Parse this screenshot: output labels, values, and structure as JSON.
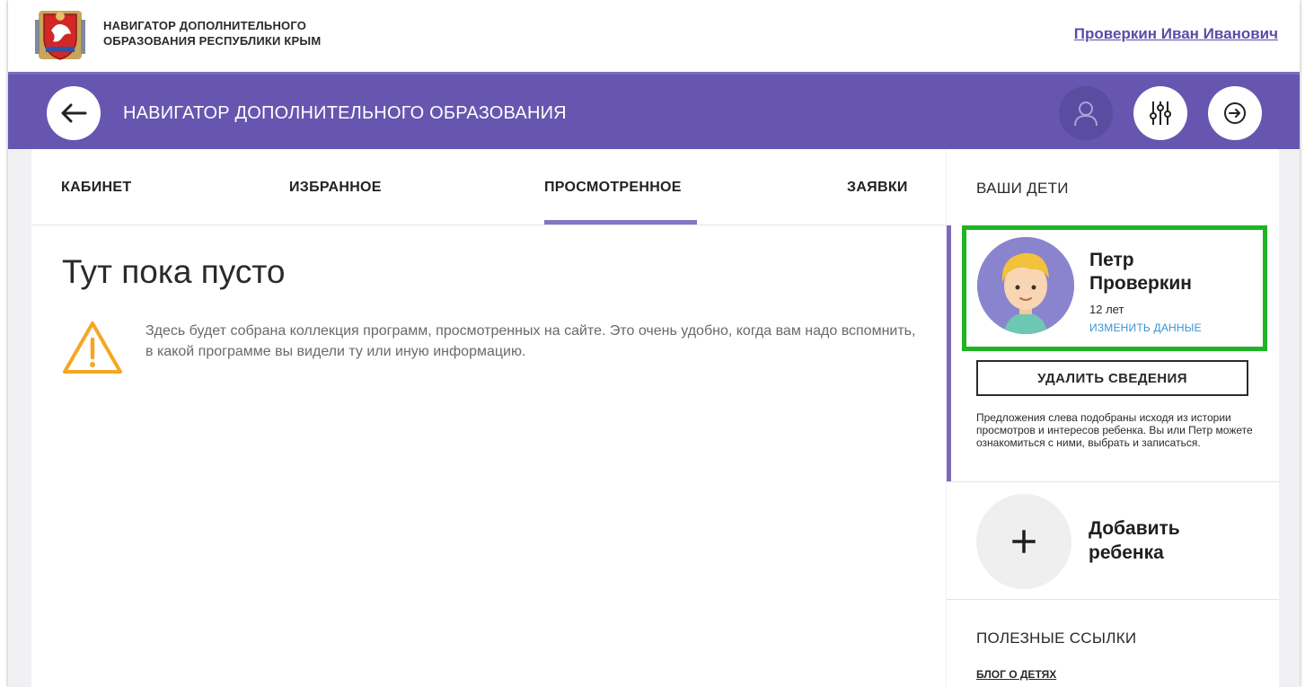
{
  "site": {
    "title_line1": "НАВИГАТОР ДОПОЛНИТЕЛЬНОГО",
    "title_line2": "ОБРАЗОВАНИЯ РЕСПУБЛИКИ КРЫМ",
    "user_name": "Проверкин Иван Иванович"
  },
  "header": {
    "title": "НАВИГАТОР ДОПОЛНИТЕЛЬНОГО ОБРАЗОВАНИЯ",
    "back_icon": "arrow-left-icon",
    "profile_icon": "user-icon",
    "filter_icon": "sliders-icon",
    "exit_icon": "exit-arrow-icon",
    "accent_color": "#6656b0"
  },
  "tabs": [
    {
      "label": "КАБИНЕТ",
      "active": false
    },
    {
      "label": "ИЗБРАННОЕ",
      "active": false
    },
    {
      "label": "ПРОСМОТРЕННОЕ",
      "active": true
    },
    {
      "label": "ЗАЯВКИ",
      "active": false
    }
  ],
  "empty_state": {
    "title": "Тут пока пусто",
    "text": "Здесь будет собрана коллекция программ, просмотренных на сайте. Это очень удобно, когда вам надо вспомнить, в какой программе вы видели ту или иную информацию.",
    "icon": "warning-icon",
    "icon_color": "#f5a623"
  },
  "sidebar": {
    "heading": "ВАШИ ДЕТИ",
    "child": {
      "first_name": "Петр",
      "last_name": "Проверкин",
      "age": "12 лет",
      "edit_label": "ИЗМЕНИТЬ ДАННЫЕ",
      "highlight_color": "#1eb424"
    },
    "delete_label": "УДАЛИТЬ СВЕДЕНИЯ",
    "note": "Предложения слева подобраны исходя из истории просмотров и интересов ребенка. Вы или Петр можете ознакомиться с ними, выбрать и записаться.",
    "add_child_line1": "Добавить",
    "add_child_line2": "ребенка",
    "links_heading": "ПОЛЕЗНЫЕ ССЫЛКИ",
    "blog_link": "БЛОГ О ДЕТЯХ"
  }
}
